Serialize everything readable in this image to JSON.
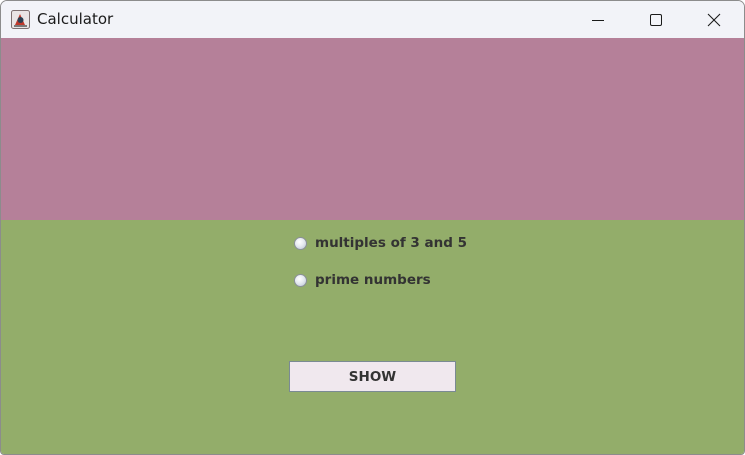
{
  "window": {
    "title": "Calculator",
    "app_icon": "java-app-icon",
    "controls": {
      "minimize_icon": "minimize-icon",
      "maximize_icon": "maximize-icon",
      "close_icon": "close-icon"
    }
  },
  "panels": {
    "top_color": "#b58099",
    "bottom_color": "#93ad6a"
  },
  "options": [
    {
      "label": "multiples of 3 and 5",
      "selected": false
    },
    {
      "label": "prime numbers",
      "selected": false
    }
  ],
  "actions": {
    "show_label": "SHOW"
  }
}
